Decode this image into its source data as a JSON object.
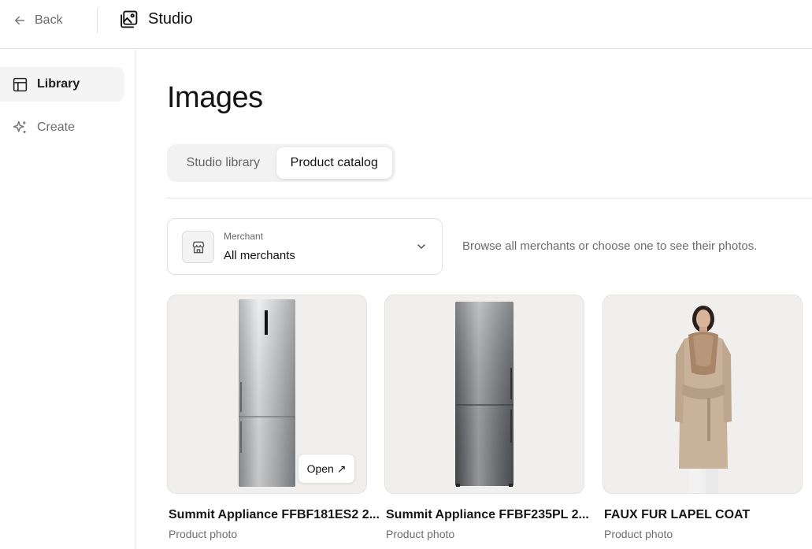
{
  "header": {
    "back_label": "Back",
    "app_title": "Studio"
  },
  "sidebar": {
    "items": [
      {
        "label": "Library",
        "icon": "layout-icon",
        "active": true
      },
      {
        "label": "Create",
        "icon": "sparkle-icon",
        "active": false
      }
    ]
  },
  "main": {
    "title": "Images",
    "tabs": [
      {
        "label": "Studio library",
        "selected": false
      },
      {
        "label": "Product catalog",
        "selected": true
      }
    ],
    "merchant": {
      "label": "Merchant",
      "value": "All merchants",
      "icon": "store-icon"
    },
    "hint": "Browse all merchants or choose one to see their photos.",
    "products": [
      {
        "title": "Summit Appliance FFBF181ES2 2...",
        "subtitle": "Product photo",
        "open_label": "Open ↗"
      },
      {
        "title": "Summit Appliance FFBF235PL 2...",
        "subtitle": "Product photo"
      },
      {
        "title": "FAUX FUR LAPEL COAT",
        "subtitle": "Product photo"
      }
    ]
  },
  "colors": {
    "active_nav_bg": "#f4f4f4",
    "card_bg": "#f0efed",
    "border": "#e3e3e3"
  }
}
